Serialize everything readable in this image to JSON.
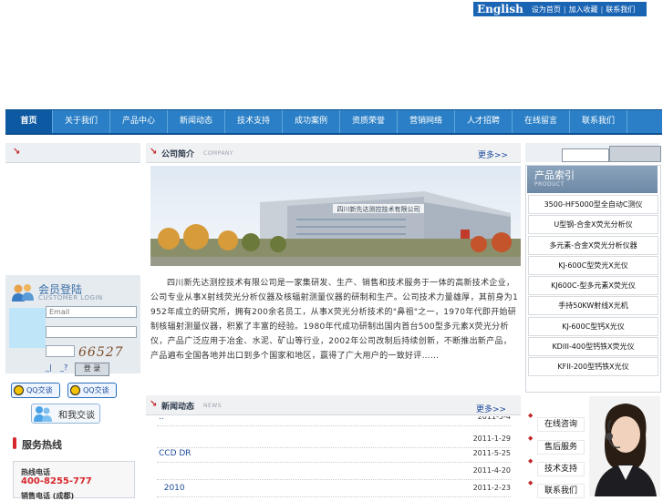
{
  "topbar": {
    "lang": "English",
    "links": [
      "设为首页",
      "加入收藏",
      "联系我们"
    ],
    "separator": "|"
  },
  "nav": {
    "items": [
      "首页",
      "关于我们",
      "产品中心",
      "新闻动态",
      "技术支持",
      "成功案例",
      "资质荣誉",
      "营销网络",
      "人才招聘",
      "在线留言",
      "联系我们"
    ]
  },
  "left": {
    "login": {
      "title": "会员登陆",
      "subtitle": "CUSTOMER  LOGIN",
      "email_placeholder": "Email",
      "captcha": "66527",
      "link_register": "_|",
      "link_forgot": "_?",
      "submit": "登 录"
    },
    "qq": [
      "QQ交谈",
      "QQ交谈"
    ],
    "talk": "和我交谈",
    "service": {
      "title": "服务热线",
      "hotline_label": "热线电话",
      "hotline": "400-8255-777",
      "sales_label": "销售电话 (成都)"
    }
  },
  "company": {
    "title": "公司简介",
    "sub": "COMPANY",
    "more": "更多>>",
    "building_sign": "四川新先达测控技术有限公司",
    "intro": "四川新先达测控技术有限公司是一家集研发、生产、销售和技术服务于一体的高新技术企业，公司专业从事X射线荧光分析仪器及核辐射测量仪器的研制和生产。公司技术力量雄厚，其前身为1952年成立的研究所，拥有200余名员工，从事X荧光分析技术的\"鼻祖\"之一，1970年代即开始研制核辐射测量仪器，积累了丰富的经验。1980年代成功研制出国内首台500型多元素X荧光分析仪，产品广泛应用于冶金、水泥、矿山等行业，2002年公司改制后持续创新，不断推出新产品，产品遍布全国各地并出口到多个国家和地区，赢得了广大用户的一致好评……"
  },
  "news": {
    "title": "新闻动态",
    "sub": "NEWS",
    "more": "更多>>",
    "items": [
      {
        "title": "..",
        "date": "2011-5-4"
      },
      {
        "title": "",
        "date": "2011-1-29"
      },
      {
        "title": "CCD   DR",
        "date": "2011-5-25"
      },
      {
        "title": "",
        "date": "2011-4-20"
      },
      {
        "title": "  2010",
        "date": "2011-2-23"
      }
    ]
  },
  "right": {
    "search_btn": "",
    "product_title": "产品索引",
    "product_sub": "PRODUCT",
    "products": [
      "3500-HF5000型全自动C测仪",
      "U型钢-合金X荧光分析仪",
      "多元素-合金X荧光分析仪器",
      "KJ-600C型荧光X光仪",
      "KJ600C-型多元素X荧光仪",
      "手持50KW射线X光机",
      "KJ-600C型钙X光仪",
      "KDIII-400型钙铁X荧光仪",
      "KFII-200型钙铁X光仪"
    ],
    "service_items": [
      "在线咨询",
      "售后服务",
      "技术支持",
      "联系我们"
    ]
  },
  "colors": {
    "nav_bg": "#2a7fc6",
    "accent_red": "#d7262c",
    "topbar_bg": "#1a64b4"
  }
}
